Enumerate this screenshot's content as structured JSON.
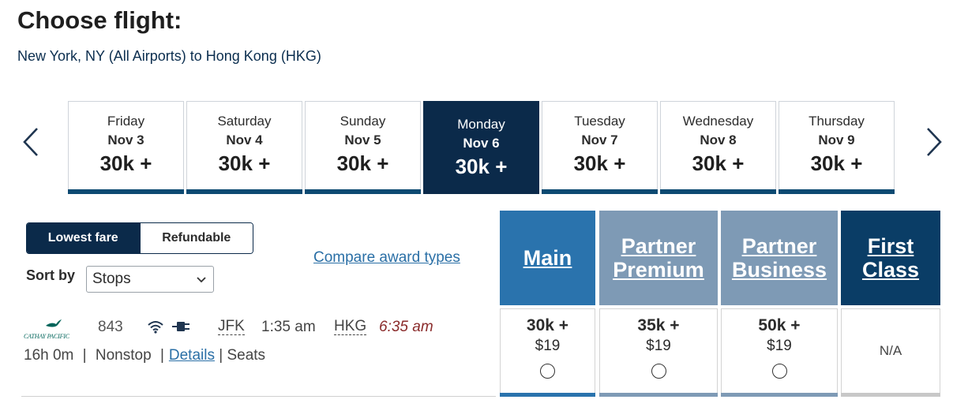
{
  "header": {
    "title": "Choose flight:",
    "route": "New York, NY (All Airports) to Hong Kong (HKG)"
  },
  "date_nav": {
    "prev_icon": "chevron-left-icon",
    "next_icon": "chevron-right-icon",
    "dates": [
      {
        "day": "Friday",
        "date": "Nov 3",
        "price": "30k +"
      },
      {
        "day": "Saturday",
        "date": "Nov 4",
        "price": "30k +"
      },
      {
        "day": "Sunday",
        "date": "Nov 5",
        "price": "30k +"
      },
      {
        "day": "Monday",
        "date": "Nov 6",
        "price": "30k +",
        "selected": true
      },
      {
        "day": "Tuesday",
        "date": "Nov 7",
        "price": "30k +"
      },
      {
        "day": "Wednesday",
        "date": "Nov 8",
        "price": "30k +"
      },
      {
        "day": "Thursday",
        "date": "Nov 9",
        "price": "30k +"
      }
    ]
  },
  "fare_toggle": {
    "lowest_fare": "Lowest fare",
    "refundable": "Refundable",
    "selected": "Lowest fare"
  },
  "sort": {
    "label": "Sort by",
    "value": "Stops"
  },
  "compare_link": "Compare award types",
  "fare_columns": [
    {
      "line1": "Main",
      "line2": "",
      "color": "#2a73ad"
    },
    {
      "line1": "Partner",
      "line2": "Premium",
      "color": "#7e9ab5"
    },
    {
      "line1": "Partner",
      "line2": "Business",
      "color": "#7e9ab5"
    },
    {
      "line1": "First",
      "line2": "Class",
      "color": "#0a3d66"
    }
  ],
  "flight": {
    "airline_logo_text": "CATHAY PACIFIC",
    "flight_number": "843",
    "amenities": [
      "wifi-icon",
      "power-outlet-icon"
    ],
    "origin": "JFK",
    "departure_time": "1:35 am",
    "destination": "HKG",
    "arrival_time": "6:35 am",
    "duration": "16h 0m",
    "stops": "Nonstop",
    "details_label": "Details",
    "seats_label": "Seats",
    "separator": "|",
    "fares": [
      {
        "price": "30k +",
        "tax": "$19",
        "available": true,
        "bar_color": "#2a73ad"
      },
      {
        "price": "35k +",
        "tax": "$19",
        "available": true,
        "bar_color": "#7e9ab5"
      },
      {
        "price": "50k +",
        "tax": "$19",
        "available": true,
        "bar_color": "#7e9ab5"
      },
      {
        "price": "N/A",
        "tax": "",
        "available": false,
        "bar_color": "#c8c8c8"
      }
    ]
  }
}
